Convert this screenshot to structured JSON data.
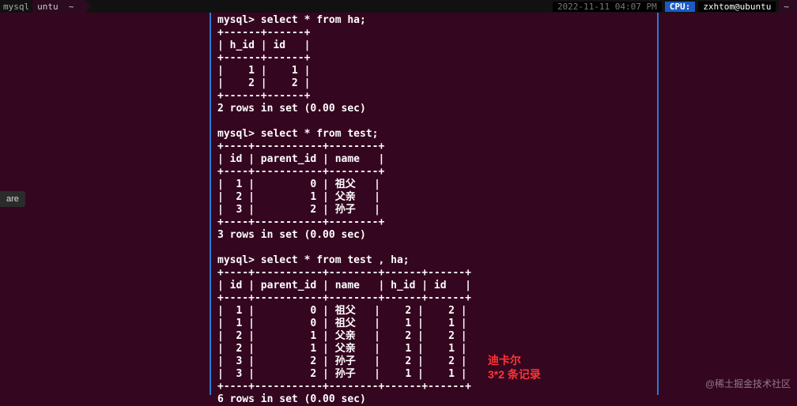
{
  "topbar": {
    "mysql_tab": "mysql",
    "ubuntu_tab": "untu",
    "tilde1": "~",
    "datetime": "2022-11-11    04:07 PM",
    "cpu": "CPU:",
    "user_host": "zxhtom@ubuntu",
    "tilde2": "~"
  },
  "share_label": "are",
  "annotation": {
    "line1": "迪卡尔",
    "line2": "3*2 条记录"
  },
  "watermark": "@稀土掘金技术社区",
  "query1": {
    "prompt": "mysql> select * from ha;",
    "border": "+------+------+",
    "header": "| h_id | id   |",
    "rows": [
      "|    1 |    1 |",
      "|    2 |    2 |"
    ],
    "footer": "2 rows in set (0.00 sec)"
  },
  "query2": {
    "prompt": "mysql> select * from test;",
    "border": "+----+-----------+--------+",
    "header": "| id | parent_id | name   |",
    "rows": [
      "|  1 |         0 | 祖父   |",
      "|  2 |         1 | 父亲   |",
      "|  3 |         2 | 孙子   |"
    ],
    "footer": "3 rows in set (0.00 sec)"
  },
  "query3": {
    "prompt": "mysql> select * from test , ha;",
    "border": "+----+-----------+--------+------+------+",
    "header": "| id | parent_id | name   | h_id | id   |",
    "rows": [
      "|  1 |         0 | 祖父   |    2 |    2 |",
      "|  1 |         0 | 祖父   |    1 |    1 |",
      "|  2 |         1 | 父亲   |    2 |    2 |",
      "|  2 |         1 | 父亲   |    1 |    1 |",
      "|  3 |         2 | 孙子   |    2 |    2 |",
      "|  3 |         2 | 孙子   |    1 |    1 |"
    ],
    "footer": "6 rows in set (0.00 sec)"
  }
}
